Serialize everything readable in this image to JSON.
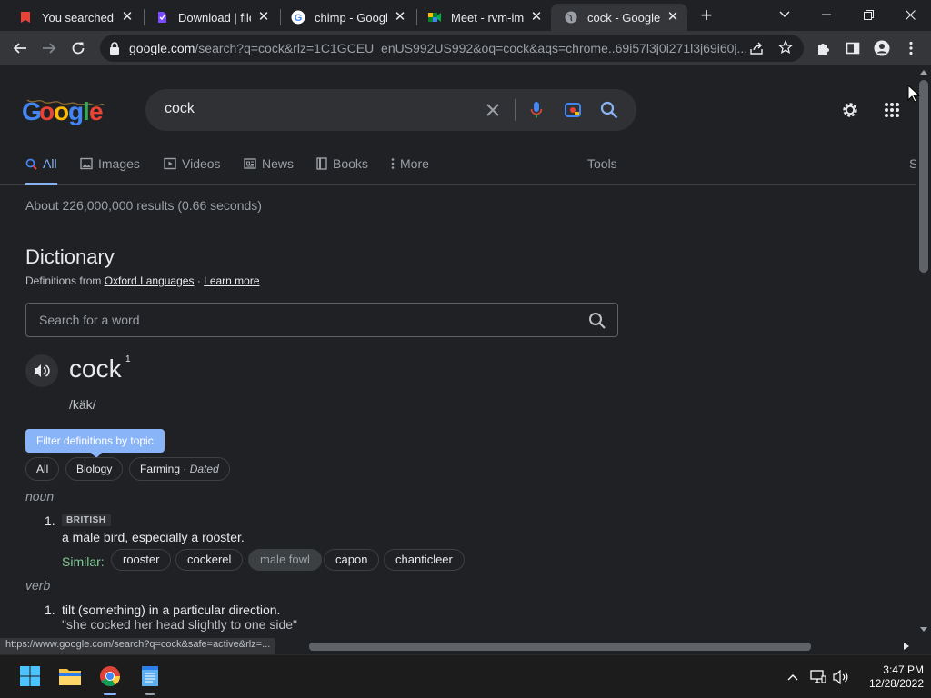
{
  "browser": {
    "tabs": [
      {
        "title": "You searched fo",
        "favicon": "red-alert-icon"
      },
      {
        "title": "Download | file.",
        "favicon": "purple-file-icon"
      },
      {
        "title": "chimp - Google",
        "favicon": "google-g-icon"
      },
      {
        "title": "Meet - rvm-imn",
        "favicon": "meet-icon"
      },
      {
        "title": "cock - Google S",
        "favicon": "globe-icon"
      }
    ],
    "url_host": "google.com",
    "url_path": "/search?q=cock&rlz=1C1GCEU_enUS992US992&oq=cock&aqs=chrome..69i57l3j0i271l3j69i60j..."
  },
  "search": {
    "query": "cock"
  },
  "nav_tabs": [
    "All",
    "Images",
    "Videos",
    "News",
    "Books",
    "More"
  ],
  "tools_label": "Tools",
  "safesearch_partial": "S",
  "result_stats": "About 226,000,000 results (0.66 seconds)",
  "dictionary": {
    "heading": "Dictionary",
    "source_prefix": "Definitions from",
    "source_link": "Oxford Languages",
    "source_sep": "·",
    "learn_more": "Learn more",
    "search_placeholder": "Search for a word",
    "word": "cock",
    "homograph": "1",
    "phonetic": "/käk/",
    "filter_button": "Filter definitions by topic",
    "topic_chips": [
      "All",
      "Biology"
    ],
    "topic_chip_farming": "Farming",
    "topic_chip_farming_note": "Dated",
    "noun": {
      "pos": "noun",
      "number": "1.",
      "badge": "BRITISH",
      "definition": "a male bird, especially a rooster.",
      "similar_label": "Similar:",
      "synonyms": [
        "rooster",
        "cockerel",
        "male fowl",
        "capon",
        "chanticleer"
      ]
    },
    "verb": {
      "pos": "verb",
      "number": "1.",
      "definition": "tilt (something) in a particular direction.",
      "example": "\"she cocked her head slightly to one side\""
    }
  },
  "status_url": "https://www.google.com/search?q=cock&safe=active&rlz=...",
  "taskbar": {
    "time": "3:47 PM",
    "date": "12/28/2022"
  }
}
